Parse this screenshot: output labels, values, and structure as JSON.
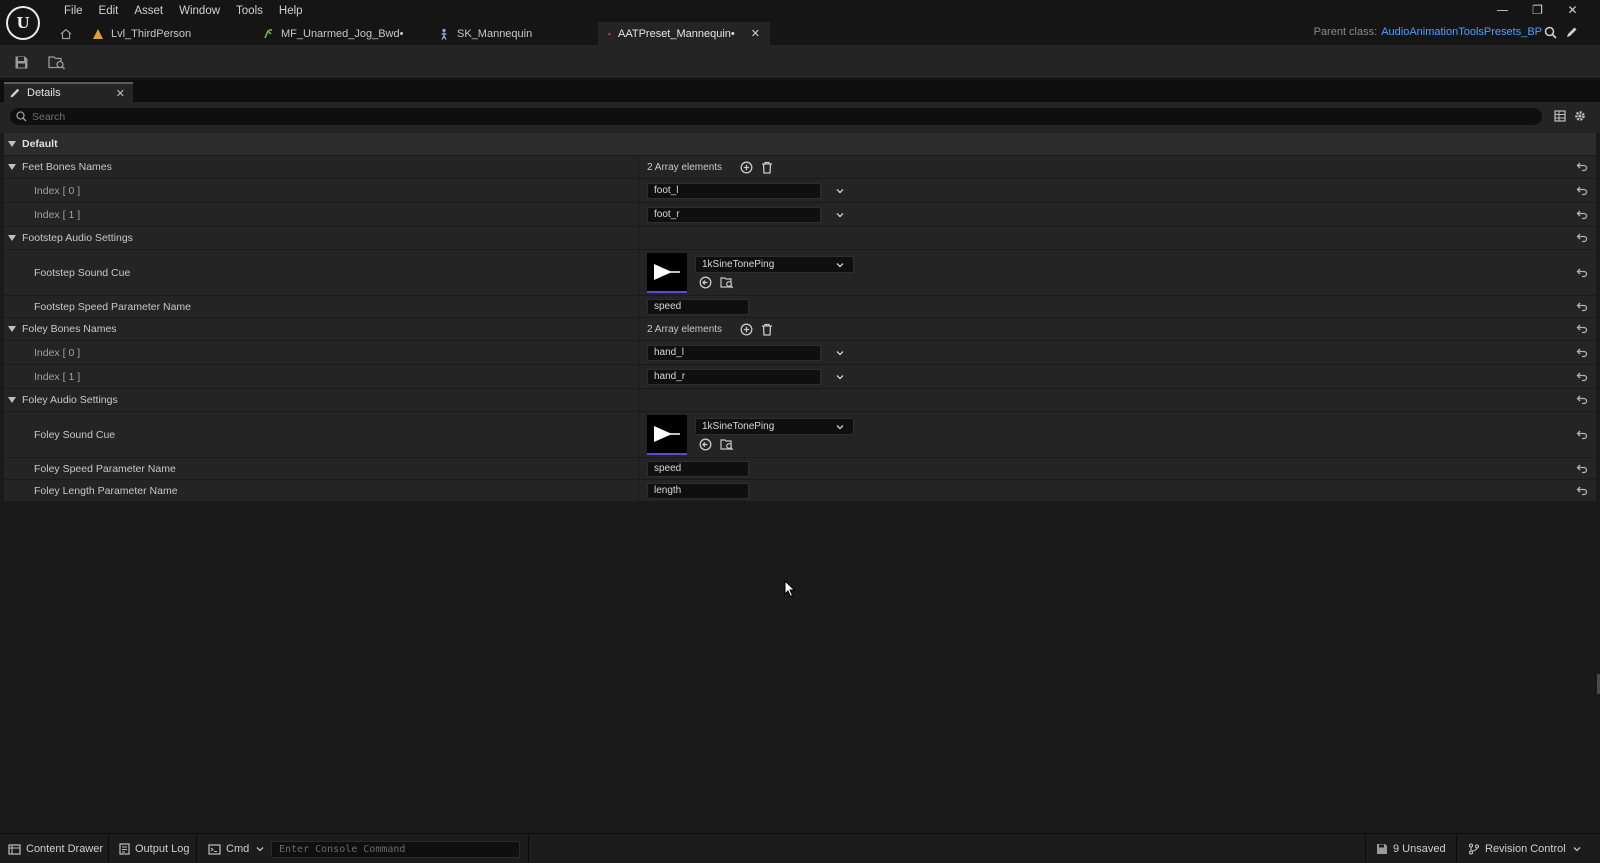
{
  "menu": [
    "File",
    "Edit",
    "Asset",
    "Window",
    "Tools",
    "Help"
  ],
  "tabs": [
    {
      "label": "Lvl_ThirdPerson",
      "icon": "level-icon"
    },
    {
      "label": "MF_Unarmed_Jog_Bwd•",
      "icon": "animation-icon"
    },
    {
      "label": "SK_Mannequin",
      "icon": "skeleton-icon"
    },
    {
      "label": "AATPreset_Mannequin•",
      "icon": "data-asset-icon"
    }
  ],
  "parent_class": {
    "label": "Parent class:",
    "value": "AudioAnimationToolsPresets_BP"
  },
  "details_tab": "Details",
  "search_placeholder": "Search",
  "rows": {
    "default": "Default",
    "feet_bones": {
      "label": "Feet Bones Names",
      "count": "2 Array elements"
    },
    "feet_idx0": {
      "label": "Index [ 0 ]",
      "value": "foot_l"
    },
    "feet_idx1": {
      "label": "Index [ 1 ]",
      "value": "foot_r"
    },
    "footstep_settings": "Footstep Audio Settings",
    "footstep_cue": {
      "label": "Footstep Sound Cue",
      "value": "1kSineTonePing"
    },
    "footstep_speed": {
      "label": "Footstep Speed Parameter Name",
      "value": "speed"
    },
    "foley_bones": {
      "label": "Foley Bones Names",
      "count": "2 Array elements"
    },
    "foley_idx0": {
      "label": "Index [ 0 ]",
      "value": "hand_l"
    },
    "foley_idx1": {
      "label": "Index [ 1 ]",
      "value": "hand_r"
    },
    "foley_settings": "Foley Audio Settings",
    "foley_cue": {
      "label": "Foley Sound Cue",
      "value": "1kSineTonePing"
    },
    "foley_speed": {
      "label": "Foley Speed Parameter Name",
      "value": "speed"
    },
    "foley_length": {
      "label": "Foley Length Parameter Name",
      "value": "length"
    }
  },
  "statusbar": {
    "content_drawer": "Content Drawer",
    "output_log": "Output Log",
    "cmd": "Cmd",
    "console_placeholder": "Enter Console Command",
    "unsaved": "9 Unsaved",
    "revision_control": "Revision Control"
  },
  "colors": {
    "accent": "#4aa0ff",
    "tab_icon": "#e0305a",
    "thumb_underline": "#5b4ad6"
  }
}
